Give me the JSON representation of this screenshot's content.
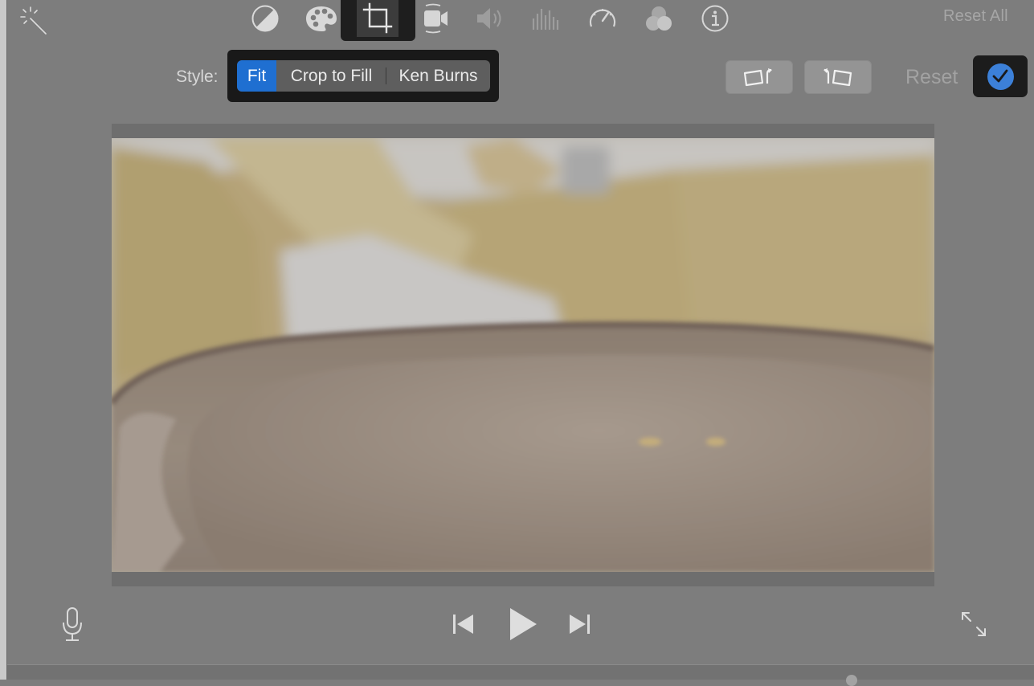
{
  "toolbar": {
    "icons": [
      "magic-wand-icon",
      "color-balance-icon",
      "color-palette-icon",
      "crop-icon",
      "stabilization-camera-icon",
      "volume-icon",
      "equalizer-icon",
      "speed-gauge-icon",
      "clip-filter-icon",
      "info-icon"
    ],
    "selected_tool": "crop-icon",
    "reset_all_label": "Reset All"
  },
  "crop": {
    "style_label": "Style:",
    "options": [
      "Fit",
      "Crop to Fill",
      "Ken Burns"
    ],
    "selected": "Fit",
    "rotate_left_icon": "rotate-counterclockwise-icon",
    "rotate_right_icon": "rotate-clockwise-icon",
    "reset_label": "Reset",
    "apply_icon": "checkmark-icon"
  },
  "viewer": {
    "transport_icons": [
      "microphone-icon",
      "skip-back-icon",
      "play-icon",
      "skip-forward-icon",
      "fullscreen-icon"
    ]
  },
  "colors": {
    "background": "#7d7d7d",
    "selected_segment": "#1f6fd1",
    "apply_button": "#3c80d8"
  }
}
